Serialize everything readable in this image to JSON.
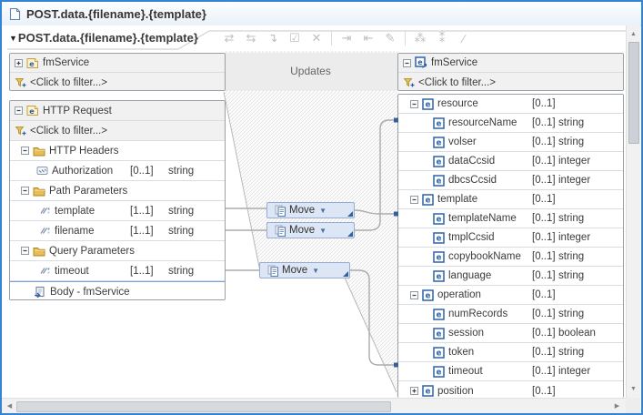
{
  "window": {
    "title": "POST.data.{filename}.{template}"
  },
  "toolbar": {
    "breadcrumb": "POST.data.{filename}.{template}",
    "icons": [
      {
        "name": "submap-icon",
        "glyph": "⇄"
      },
      {
        "name": "local-map-icon",
        "glyph": "⇆"
      },
      {
        "name": "cast-icon",
        "glyph": "↴"
      },
      {
        "name": "validate-map-icon",
        "glyph": "☑"
      },
      {
        "name": "delete-transform-icon",
        "glyph": "✕"
      },
      {
        "name": "link-inputs-icon",
        "glyph": "⇥"
      },
      {
        "name": "link-outputs-icon",
        "glyph": "⇤"
      },
      {
        "name": "edit-transform-icon",
        "glyph": "✎"
      },
      {
        "name": "add-connection-icon",
        "glyph": "⁂"
      },
      {
        "name": "remove-connection-icon",
        "glyph": "⁑"
      },
      {
        "name": "annotation-icon",
        "glyph": "⁄"
      }
    ]
  },
  "canvas": {
    "updates_label": "Updates",
    "transforms": [
      {
        "label": "Move"
      },
      {
        "label": "Move"
      },
      {
        "label": "Move"
      }
    ],
    "connections": [
      {
        "from": "template",
        "transform": "Move",
        "to": "templateName"
      },
      {
        "from": "filename",
        "transform": "Move",
        "to": "resourceName"
      },
      {
        "from": "timeout",
        "transform": "Move",
        "to": "timeout"
      }
    ]
  },
  "input_panel": {
    "service": {
      "label": "fmService",
      "filter": "<Click to filter...>"
    },
    "request": {
      "title": "HTTP Request",
      "filter": "<Click to filter...>",
      "rows": [
        {
          "kind": "group",
          "icon": "folder",
          "label": "HTTP Headers",
          "cardinality": "",
          "type": ""
        },
        {
          "kind": "field",
          "icon": "attr",
          "label": "Authorization",
          "cardinality": "[0..1]",
          "type": "string"
        },
        {
          "kind": "group",
          "icon": "folder",
          "label": "Path Parameters",
          "cardinality": "",
          "type": ""
        },
        {
          "kind": "field",
          "icon": "param",
          "label": "template",
          "cardinality": "[1..1]",
          "type": "string"
        },
        {
          "kind": "field",
          "icon": "param",
          "label": "filename",
          "cardinality": "[1..1]",
          "type": "string"
        },
        {
          "kind": "group",
          "icon": "folder",
          "label": "Query Parameters",
          "cardinality": "",
          "type": ""
        },
        {
          "kind": "field",
          "icon": "param",
          "label": "timeout",
          "cardinality": "[1..1]",
          "type": "string"
        },
        {
          "kind": "body",
          "icon": "body",
          "label": "Body - fmService",
          "cardinality": "",
          "type": ""
        }
      ]
    }
  },
  "output_panel": {
    "service": {
      "label": "fmService",
      "filter": "<Click to filter...>"
    },
    "rows": [
      {
        "level": 1,
        "expander": "minus",
        "label": "resource",
        "cardinality": "[0..1]",
        "type": ""
      },
      {
        "level": 2,
        "expander": "",
        "label": "resourceName",
        "cardinality": "[0..1]",
        "type": "string"
      },
      {
        "level": 2,
        "expander": "",
        "label": "volser",
        "cardinality": "[0..1]",
        "type": "string"
      },
      {
        "level": 2,
        "expander": "",
        "label": "dataCcsid",
        "cardinality": "[0..1]",
        "type": "integer"
      },
      {
        "level": 2,
        "expander": "",
        "label": "dbcsCcsid",
        "cardinality": "[0..1]",
        "type": "integer"
      },
      {
        "level": 1,
        "expander": "minus",
        "label": "template",
        "cardinality": "[0..1]",
        "type": ""
      },
      {
        "level": 2,
        "expander": "",
        "label": "templateName",
        "cardinality": "[0..1]",
        "type": "string"
      },
      {
        "level": 2,
        "expander": "",
        "label": "tmplCcsid",
        "cardinality": "[0..1]",
        "type": "integer"
      },
      {
        "level": 2,
        "expander": "",
        "label": "copybookName",
        "cardinality": "[0..1]",
        "type": "string"
      },
      {
        "level": 2,
        "expander": "",
        "label": "language",
        "cardinality": "[0..1]",
        "type": "string"
      },
      {
        "level": 1,
        "expander": "minus",
        "label": "operation",
        "cardinality": "[0..1]",
        "type": ""
      },
      {
        "level": 2,
        "expander": "",
        "label": "numRecords",
        "cardinality": "[0..1]",
        "type": "string"
      },
      {
        "level": 2,
        "expander": "",
        "label": "session",
        "cardinality": "[0..1]",
        "type": "boolean"
      },
      {
        "level": 2,
        "expander": "",
        "label": "token",
        "cardinality": "[0..1]",
        "type": "string"
      },
      {
        "level": 2,
        "expander": "",
        "label": "timeout",
        "cardinality": "[0..1]",
        "type": "integer"
      },
      {
        "level": 1,
        "expander": "plus",
        "label": "position",
        "cardinality": "[0..1]",
        "type": ""
      }
    ]
  }
}
